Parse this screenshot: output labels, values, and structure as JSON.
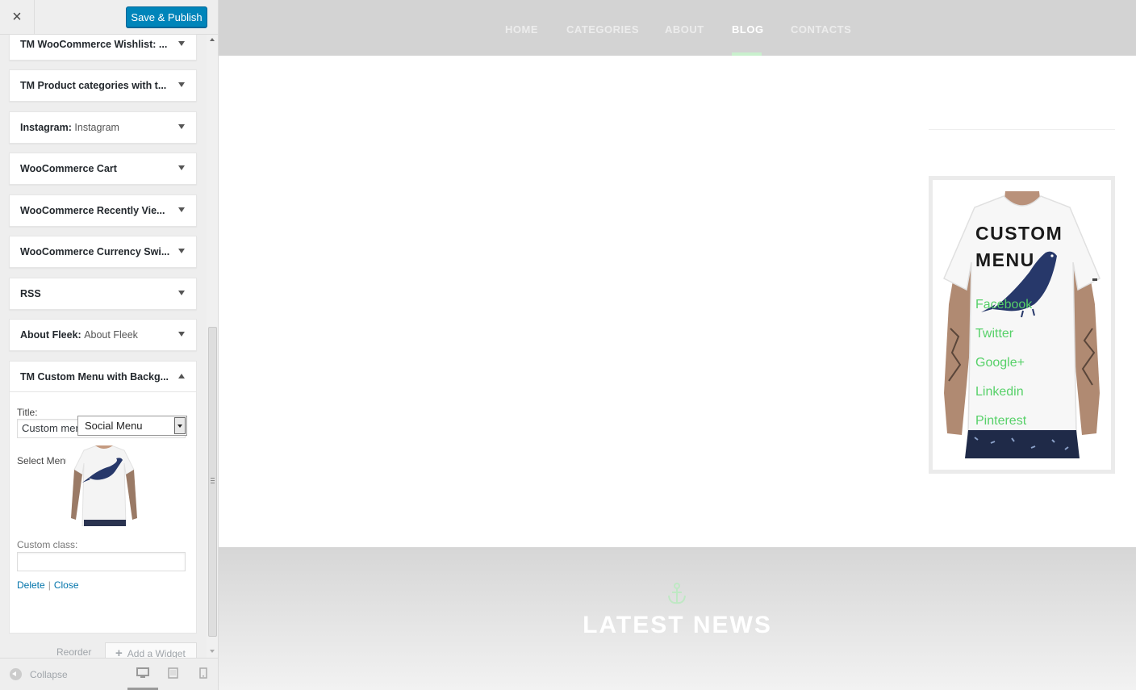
{
  "sidebar": {
    "close_icon": "×",
    "publish_label": "Save & Publish",
    "widgets": [
      {
        "title": "TM WooCommerce Wishlist: ...",
        "sub": ""
      },
      {
        "title": "TM Product categories with t...",
        "sub": ""
      },
      {
        "title": "Instagram:",
        "sub": "Instagram"
      },
      {
        "title": "WooCommerce Cart",
        "sub": ""
      },
      {
        "title": "WooCommerce Recently Vie...",
        "sub": ""
      },
      {
        "title": "WooCommerce Currency Swi...",
        "sub": ""
      },
      {
        "title": "RSS",
        "sub": ""
      },
      {
        "title": "About Fleek:",
        "sub": "About Fleek"
      }
    ],
    "open_widget": {
      "title": "TM Custom Menu with Backg...",
      "title_label": "Title:",
      "title_value": "Custom menu",
      "select_label": "Select Menu:",
      "select_value": "Social Menu",
      "custom_class_label": "Custom class:",
      "custom_class_value": "",
      "delete_label": "Delete",
      "separator": "|",
      "close_label": "Close"
    },
    "reorder_label": "Reorder",
    "add_widget_label": "Add a Widget",
    "add_widget_icon": "+",
    "collapse_label": "Collapse"
  },
  "preview": {
    "nav": [
      "HOME",
      "CATEGORIES",
      "ABOUT",
      "BLOG",
      "CONTACTS"
    ],
    "active_nav": "BLOG",
    "menu_widget": {
      "title_line1": "CUSTOM",
      "title_line2": "MENU",
      "links": [
        "Facebook",
        "Twitter",
        "Google+",
        "Linkedin",
        "Pinterest"
      ]
    },
    "latest_title": "LATEST NEWS"
  },
  "colors": {
    "publish_bg": "#0085ba",
    "link_blue": "#0073aa",
    "menu_link_green": "#57d169",
    "topbar_gray": "#d3d3d3"
  }
}
